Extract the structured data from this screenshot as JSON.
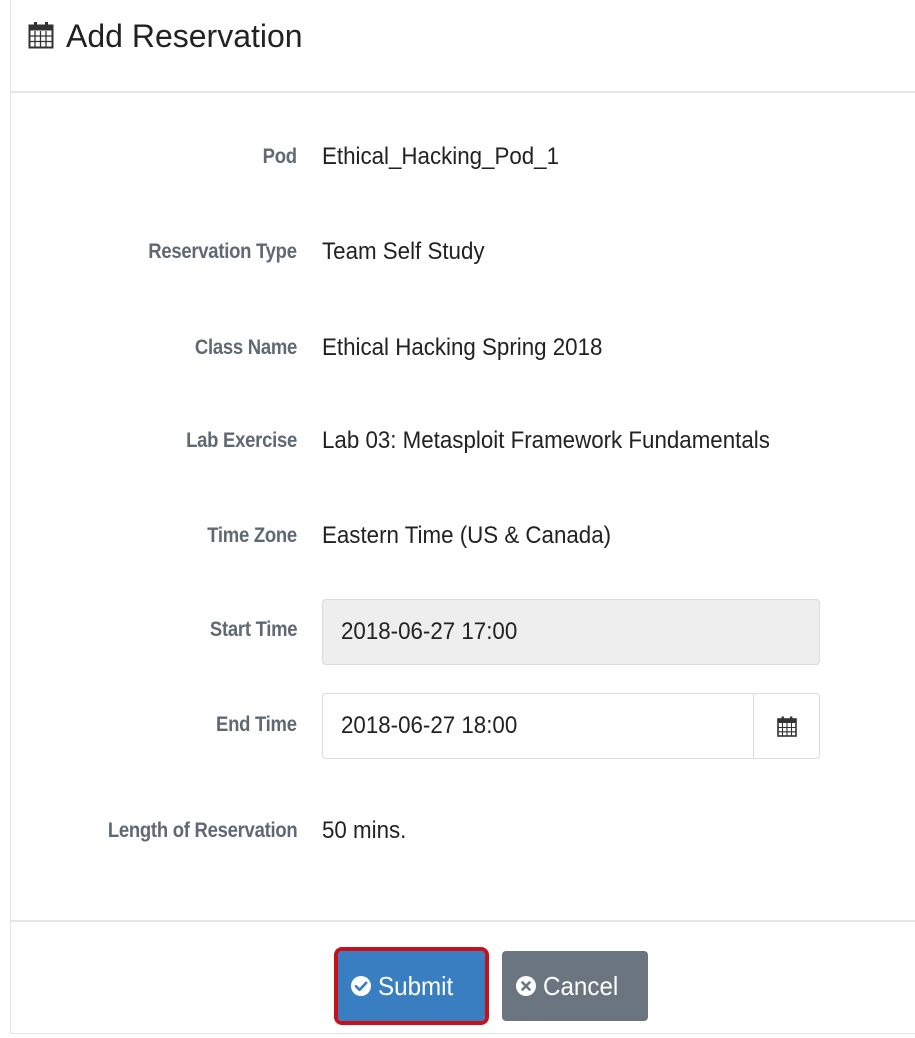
{
  "header": {
    "title": "Add Reservation",
    "icon": "calendar-icon"
  },
  "fields": {
    "pod": {
      "label": "Pod",
      "value": "Ethical_Hacking_Pod_1"
    },
    "reservation_type": {
      "label": "Reservation Type",
      "value": "Team Self Study"
    },
    "class_name": {
      "label": "Class Name",
      "value": "Ethical Hacking Spring 2018"
    },
    "lab_exercise": {
      "label": "Lab Exercise",
      "value": "Lab 03: Metasploit Framework Fundamentals"
    },
    "time_zone": {
      "label": "Time Zone",
      "value": "Eastern Time (US & Canada)"
    },
    "start_time": {
      "label": "Start Time",
      "value": "2018-06-27 17:00"
    },
    "end_time": {
      "label": "End Time",
      "value": "2018-06-27 18:00"
    },
    "length": {
      "label": "Length of Reservation",
      "value": "50 mins."
    }
  },
  "buttons": {
    "submit": {
      "label": "Submit",
      "icon": "check-circle-icon"
    },
    "cancel": {
      "label": "Cancel",
      "icon": "times-circle-icon"
    }
  },
  "colors": {
    "submit_bg": "#3a7ec2",
    "cancel_bg": "#6b7580",
    "highlight": "#c4111c",
    "label": "#5f6973"
  }
}
